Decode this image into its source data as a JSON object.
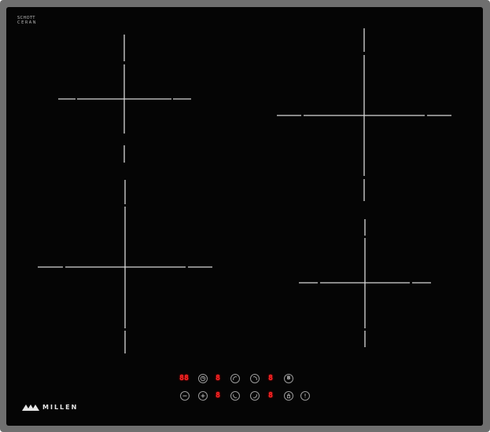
{
  "brand_mark": {
    "line1": "SCHOTT",
    "line2": "CERAN"
  },
  "logo": {
    "text": "MILLEN"
  },
  "controls": {
    "row1": [
      {
        "type": "display",
        "value": "88"
      },
      {
        "type": "button",
        "icon": "timer-icon"
      },
      {
        "type": "display",
        "value": "8"
      },
      {
        "type": "button",
        "icon": "zone-rear-left-icon"
      },
      {
        "type": "button",
        "icon": "zone-rear-right-icon"
      },
      {
        "type": "display",
        "value": "8"
      },
      {
        "type": "button",
        "icon": "boost-icon",
        "label": "B"
      }
    ],
    "row2": [
      {
        "type": "button",
        "icon": "minus-icon"
      },
      {
        "type": "button",
        "icon": "plus-icon"
      },
      {
        "type": "display",
        "value": "8"
      },
      {
        "type": "button",
        "icon": "zone-front-left-icon"
      },
      {
        "type": "button",
        "icon": "zone-front-right-icon"
      },
      {
        "type": "display",
        "value": "8"
      },
      {
        "type": "button",
        "icon": "key-lock-icon"
      },
      {
        "type": "button",
        "icon": "power-icon"
      }
    ]
  },
  "colors": {
    "glass": "#050505",
    "frame": "#6f6f6f",
    "display": "#ff2a2a",
    "marking": "#d8d8d8"
  }
}
